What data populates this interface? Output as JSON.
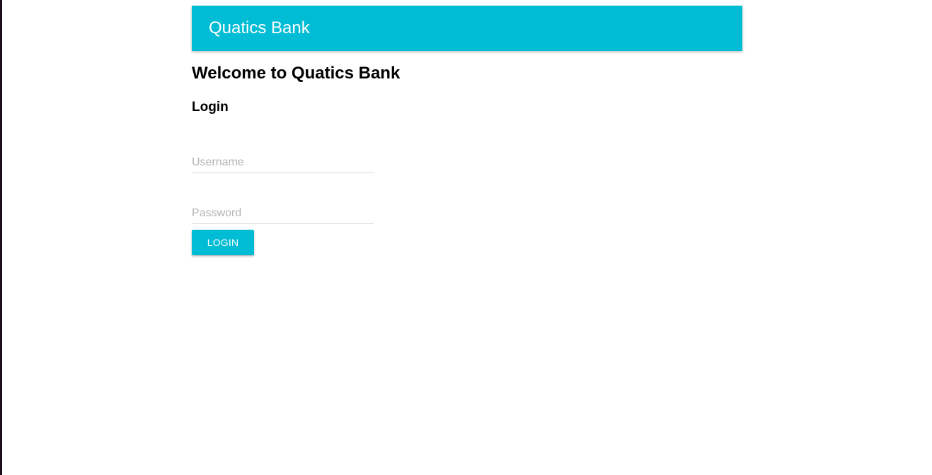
{
  "header": {
    "title": "Quatics Bank",
    "color": "#00bcd4"
  },
  "main": {
    "welcome_heading": "Welcome to Quatics Bank",
    "login_heading": "Login",
    "username": {
      "value": "",
      "placeholder": "Username"
    },
    "password": {
      "value": "",
      "placeholder": "Password"
    },
    "login_button_label": "LOGIN"
  }
}
